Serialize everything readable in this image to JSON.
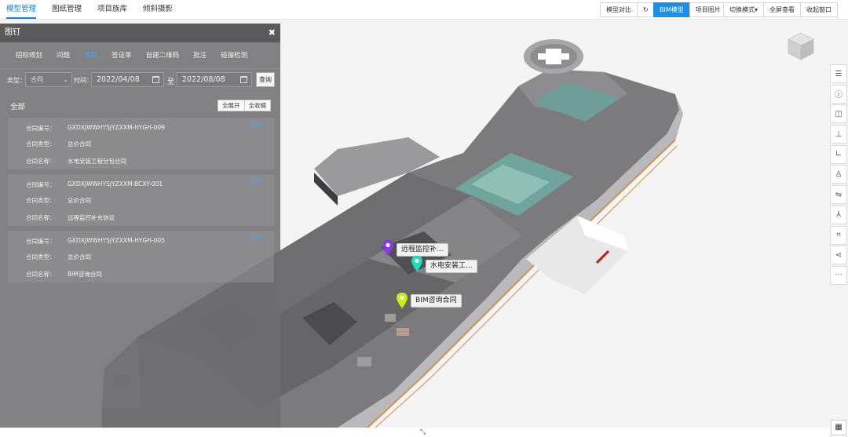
{
  "topnav": [
    {
      "label": "模型管理",
      "active": true
    },
    {
      "label": "图纸管理",
      "active": false
    },
    {
      "label": "项目族库",
      "active": false
    },
    {
      "label": "倾斜摄影",
      "active": false
    }
  ],
  "toolbar_left": {
    "compare": "模型对比",
    "refresh_icon": "refresh-icon"
  },
  "toolbar_mid": {
    "bim_model": "BIM模型",
    "project_pics": "项目图片"
  },
  "toolbar_right": {
    "switch_mode": "切换模式▾",
    "fullscreen": "全屏查看",
    "collapse": "收起窗口"
  },
  "panel": {
    "title": "图钉",
    "close": "✖",
    "tabs": [
      {
        "label": "招标规划",
        "active": false
      },
      {
        "label": "问题",
        "active": false
      },
      {
        "label": "合同",
        "active": true
      },
      {
        "label": "签证单",
        "active": false
      },
      {
        "label": "自建二维码",
        "active": false
      },
      {
        "label": "批注",
        "active": false
      },
      {
        "label": "碰撞检测",
        "active": false
      }
    ],
    "filter": {
      "type_label": "类型：",
      "type_value": "合同",
      "time_label": "时间：",
      "date_from": "2022/04/08",
      "date_sep": "至",
      "date_to": "2022/08/08",
      "query": "查询"
    },
    "section": "全部",
    "expand_all": "全展开",
    "collapse_all": "全收缩",
    "field_labels": {
      "no": "合同编号：",
      "type": "合同类型：",
      "name": "合同名称："
    },
    "expand_label": "展开",
    "cards": [
      {
        "no": "GXDXJWWHYSJYZXXM-HYGH-009",
        "type": "总价合同",
        "name": "水电安装工程分包合同"
      },
      {
        "no": "GXDXJWWHYSJYZXXM-BCXY-001",
        "type": "总价合同",
        "name": "远程监控补充协议"
      },
      {
        "no": "GXDXJWWHYSJYZXXM-HYGH-005",
        "type": "总价合同",
        "name": "BIM咨询合同"
      }
    ]
  },
  "pins": [
    {
      "label": "远程监控补...",
      "color": "#8a3be8"
    },
    {
      "label": "水电安装工...",
      "color": "#19e0c0"
    },
    {
      "label": "BIM咨询合同",
      "color": "#c8ee12"
    }
  ],
  "right_tools": [
    "tree-icon",
    "info-icon",
    "section-icon",
    "pin-icon",
    "measure-icon",
    "person-icon",
    "path-icon",
    "axis-icon",
    "crop-icon",
    "share-icon",
    "more-icon"
  ]
}
